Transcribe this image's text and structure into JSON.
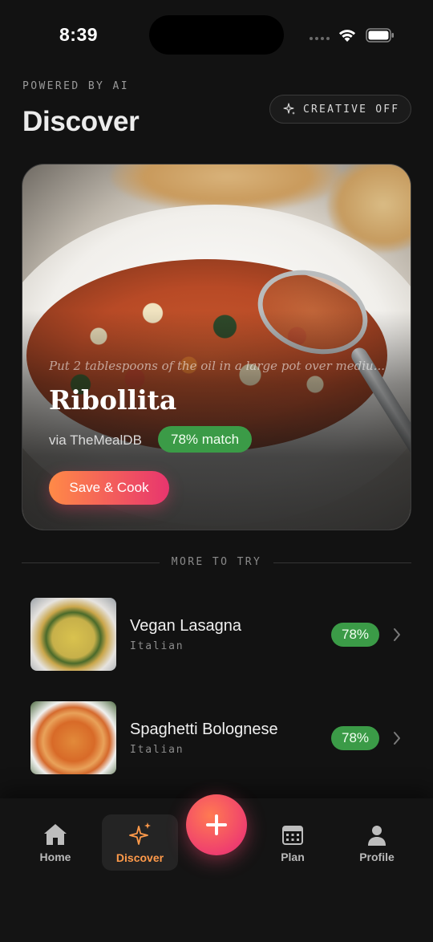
{
  "status_bar": {
    "time": "8:39"
  },
  "header": {
    "eyebrow": "POWERED BY AI",
    "title": "Discover",
    "creative_toggle": "CREATIVE OFF"
  },
  "hero": {
    "snippet": "Put 2 tablespoons of the oil in a large pot over mediu...",
    "recipe_name": "Ribollita",
    "source": "via TheMealDB",
    "match": "78% match",
    "cta": "Save & Cook"
  },
  "divider": "MORE TO TRY",
  "list": [
    {
      "name": "Vegan Lasagna",
      "cuisine": "Italian",
      "match": "78%"
    },
    {
      "name": "Spaghetti Bolognese",
      "cuisine": "Italian",
      "match": "78%"
    }
  ],
  "nav": {
    "home": "Home",
    "discover": "Discover",
    "plan": "Plan",
    "profile": "Profile"
  },
  "colors": {
    "accent_start": "#ff8a47",
    "accent_end": "#e8356e",
    "match_green": "#3b9b47",
    "background": "#121212"
  }
}
